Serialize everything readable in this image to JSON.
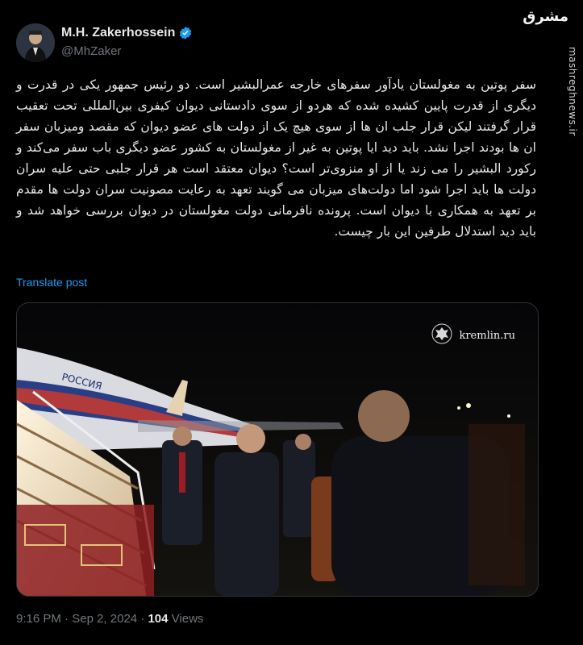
{
  "author": {
    "display_name": "M.H. Zakerhossein",
    "handle": "@MhZaker",
    "verified": true
  },
  "post": {
    "text": "سفر پوتین به مغولستان یادآور سفرهای خارجه عمرالبشیر است. دو رئیس جمهور یکی در قدرت و دیگری از قدرت پایین کشیده شده که هردو از سوی دادستانی دیوان کیفری بین‌المللی تحت تعقیب قرار گرفتند لیکن قرار جلب ان ها از سوی هیچ یک از دولت های عضو دیوان که مقصد ومیزبان سفر ان ها بودند اجرا نشد. باید دید ایا پوتین به غیر از مغولستان به کشور عضو دیگری باب سفر می‌کند و رکورد البشیر را می زند یا از او منزوی‌تر است؟ دیوان معتقد است هر قرار جلبی حتی علیه سران دولت ها باید اجرا شود اما دولت‌های میزبان می گویند تعهد به رعایت مصونیت سران دولت ها مقدم بر تعهد به همکاری با دیوان است. پرونده نافرمانی دولت مغولستان در دیوان بررسی خواهد شد و باید دید استدلال طرفین این بار چیست.",
    "translate_label": "Translate post"
  },
  "media": {
    "watermark_text": "kremlin.ru",
    "plane_livery_text": "РОССИЯ"
  },
  "meta": {
    "time": "9:16 PM",
    "separator": "·",
    "date": "Sep 2, 2024",
    "views_count": "104",
    "views_label": "Views"
  },
  "site_watermark": {
    "logo": "مشرق",
    "site": "mashreghnews.ir"
  },
  "colors": {
    "background": "#000000",
    "text_primary": "#e7e9ea",
    "text_secondary": "#71767b",
    "link": "#1d9bf0",
    "verified": "#1d9bf0"
  }
}
